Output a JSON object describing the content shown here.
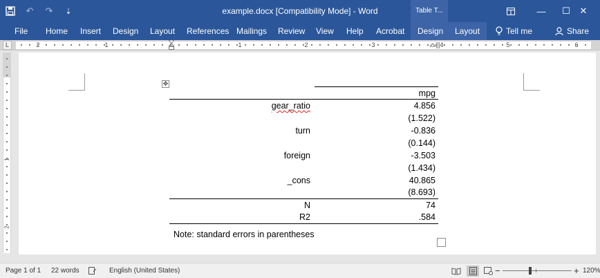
{
  "title_bar": {
    "doc_title": "example.docx [Compatibility Mode]  -  Word",
    "context_group": "Table T...",
    "icons": [
      "save-icon",
      "undo-icon",
      "redo-icon",
      "customize-qat-icon",
      "ribbon-display-options-icon",
      "minimize-icon",
      "maximize-icon",
      "close-icon"
    ],
    "glyphs": {
      "undo": "↶",
      "redo": "↷",
      "customize": "⇣",
      "minimize": "—",
      "maximize": "☐",
      "close": "✕"
    }
  },
  "ribbon": {
    "tabs": [
      "File",
      "Home",
      "Insert",
      "Design",
      "Layout",
      "References",
      "Mailings",
      "Review",
      "View",
      "Help",
      "Acrobat"
    ],
    "context_tabs": [
      "Design",
      "Layout"
    ],
    "tell_me": "Tell me",
    "share": "Share",
    "colors": {
      "ribbon": "#2b579a",
      "context_tab": "#3d64a6"
    }
  },
  "ruler": {
    "tab_selector": "L",
    "h_numbers": [
      "2",
      "1",
      "1",
      "2",
      "3",
      "4",
      "5",
      "6"
    ],
    "v_numbers": [
      "1",
      "2"
    ]
  },
  "table": {
    "header": "mpg",
    "rows": [
      {
        "label": "gear_ratio",
        "value": "4.856",
        "spellcheck": true
      },
      {
        "label": "",
        "value": "(1.522)"
      },
      {
        "label": "turn",
        "value": "-0.836"
      },
      {
        "label": "",
        "value": "(0.144)"
      },
      {
        "label": "foreign",
        "value": "-3.503"
      },
      {
        "label": "",
        "value": "(1.434)"
      },
      {
        "label": "_cons",
        "value": "40.865"
      },
      {
        "label": "",
        "value": "(8.693)"
      }
    ],
    "stats": [
      {
        "label": "N",
        "value": "74"
      },
      {
        "label": "R2",
        "value": ".584"
      }
    ],
    "note": "Note: standard errors in parentheses"
  },
  "status_bar": {
    "page": "Page 1 of 1",
    "words": "22 words",
    "language": "English (United States)",
    "zoom_out": "−",
    "zoom_in": "+",
    "zoom": "120%"
  }
}
